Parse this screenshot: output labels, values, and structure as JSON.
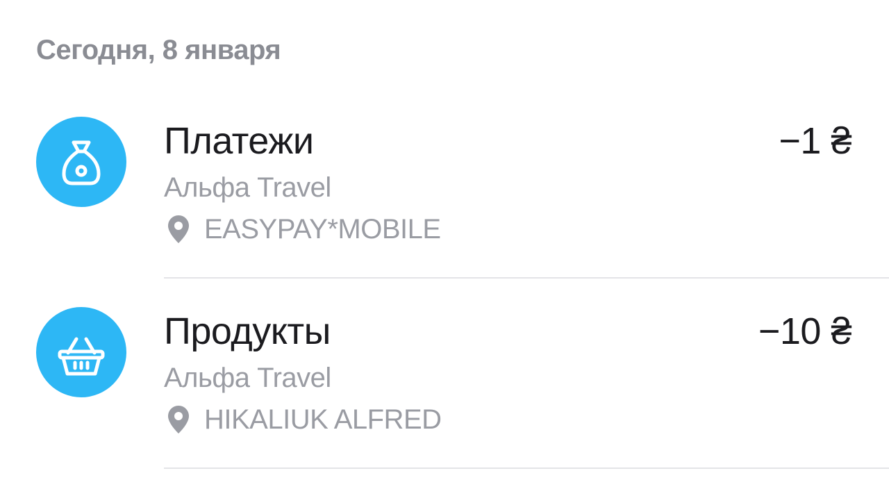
{
  "date_header": "Сегодня, 8 января",
  "colors": {
    "accent": "#2db7f5",
    "title": "#1b1b1f",
    "muted": "#9a9ca3",
    "divider": "#e3e4e7"
  },
  "transactions": [
    {
      "category": "Платежи",
      "icon": "money-bag-icon",
      "amount": "−1 ₴",
      "card": "Альфа Travel",
      "place": "EASYPAY*MOBILE"
    },
    {
      "category": "Продукты",
      "icon": "basket-icon",
      "amount": "−10 ₴",
      "card": "Альфа Travel",
      "place": "HIKALIUK ALFRED"
    }
  ]
}
